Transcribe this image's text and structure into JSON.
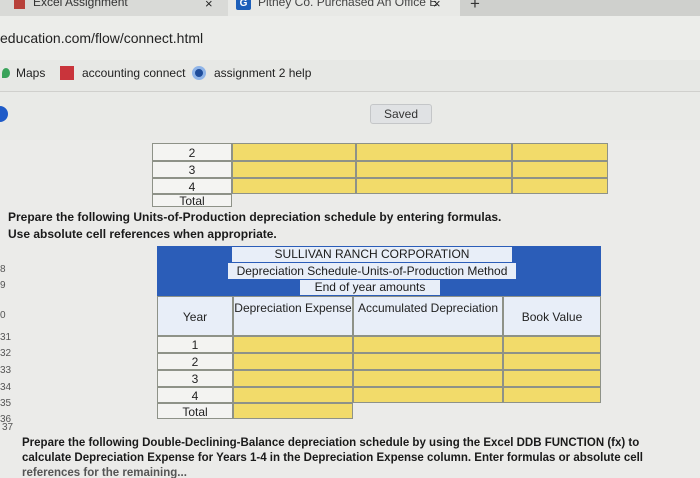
{
  "tabs": [
    {
      "title": "Excel Assignment",
      "close": "×"
    },
    {
      "title": "Pitney Co. Purchased An Office E",
      "close": "×",
      "icon": "G"
    }
  ],
  "new_tab": "+",
  "address": {
    "url": "education.com/flow/connect.html"
  },
  "bookmarks": [
    {
      "label": "Maps"
    },
    {
      "label": "accounting connect"
    },
    {
      "label": "assignment 2 help"
    }
  ],
  "status": {
    "saved": "Saved"
  },
  "top_table": {
    "rows": [
      "2",
      "3",
      "4",
      "Total"
    ]
  },
  "instructions1": [
    "Prepare the following Units-of-Production depreciation schedule by entering formulas.",
    "Use absolute cell references when appropriate."
  ],
  "schedule": {
    "company": "SULLIVAN RANCH CORPORATION",
    "title": "Depreciation Schedule-Units-of-Production Method",
    "subtitle": "End of year amounts",
    "columns": [
      "Year",
      "Depreciation Expense",
      "Accumulated Depreciation",
      "Book Value"
    ],
    "years": [
      "1",
      "2",
      "3",
      "4",
      "Total"
    ]
  },
  "row_numbers": [
    "8",
    "9",
    "0",
    "31",
    "32",
    "33",
    "34",
    "35",
    "36",
    "37"
  ],
  "instructions2": [
    "Prepare the following Double-Declining-Balance depreciation schedule by using the Excel DDB FUNCTION (fx) to",
    "calculate Depreciation Expense for Years 1-4 in the Depreciation Expense column. Enter formulas or absolute cell",
    "references for the remaining..."
  ]
}
